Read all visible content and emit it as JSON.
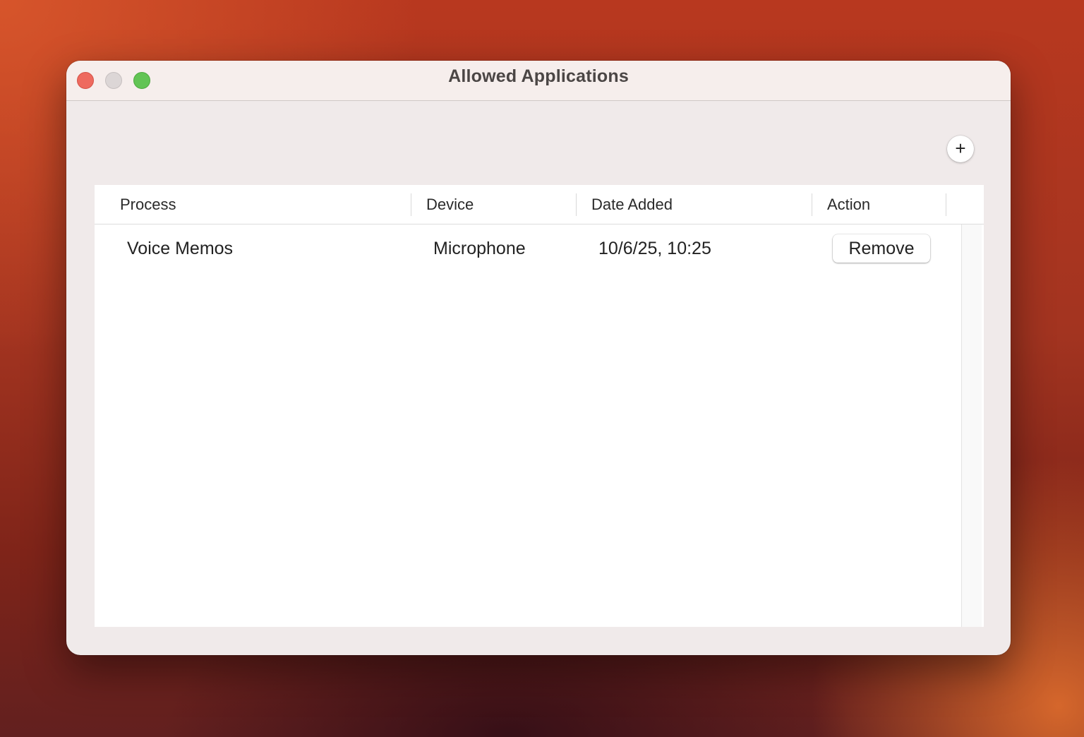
{
  "window": {
    "title": "Allowed Applications"
  },
  "toolbar": {
    "add_label": "+"
  },
  "table": {
    "columns": [
      "Process",
      "Device",
      "Date Added",
      "Action"
    ],
    "rows": [
      {
        "process": "Voice Memos",
        "device": "Microphone",
        "date_added": "10/6/25, 10:25",
        "action_label": "Remove"
      }
    ]
  },
  "icons": {
    "close": "close-icon",
    "minimize": "minimize-icon",
    "maximize": "maximize-icon",
    "add": "plus-icon"
  },
  "colors": {
    "close": "#ee6a5f",
    "minimize": "#dcd6d6",
    "maximize": "#62c454"
  }
}
